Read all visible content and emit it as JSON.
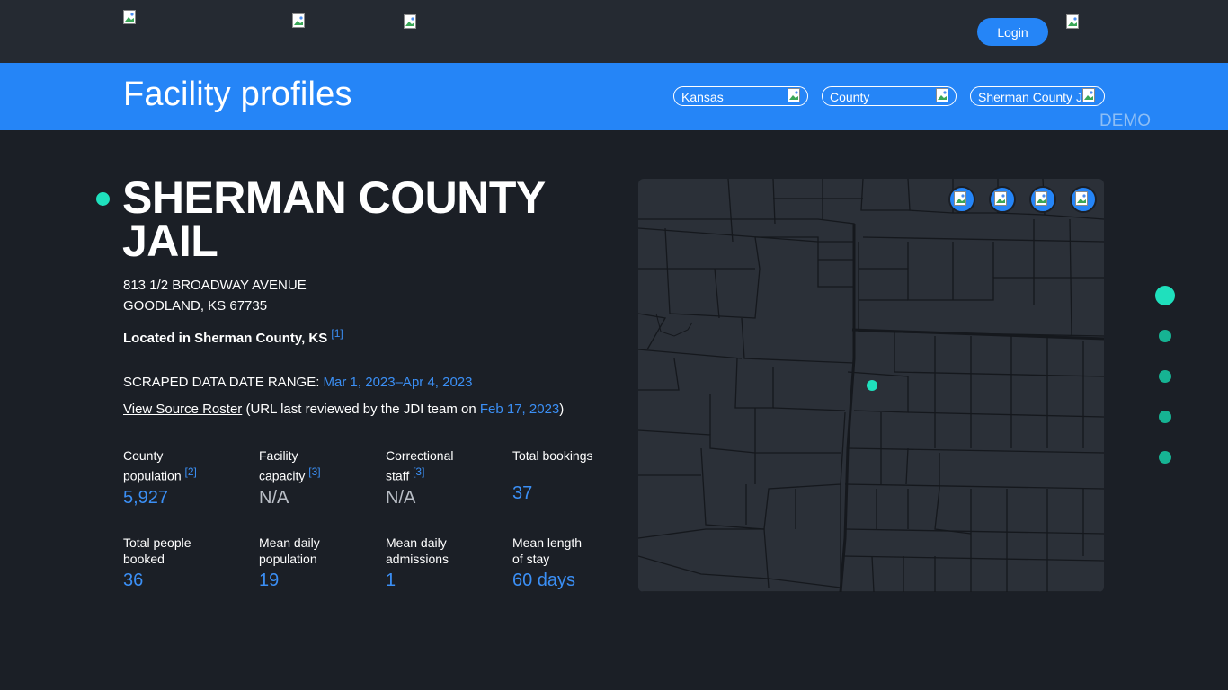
{
  "nav": {
    "login_label": "Login"
  },
  "banner": {
    "title": "Facility profiles",
    "state_select": "Kansas",
    "type_select": "County",
    "facility_select": "Sherman County J",
    "demo_label": "DEMO"
  },
  "facility": {
    "name": "SHERMAN COUNTY JAIL",
    "address_line1": "813 1/2 BROADWAY AVENUE",
    "address_line2": "GOODLAND, KS 67735",
    "located_text": "Located in Sherman County, KS",
    "located_ref": "[1]",
    "date_range_label": "SCRAPED DATA DATE RANGE:",
    "date_range_value": "Mar 1, 2023–Apr 4, 2023",
    "roster_link": "View Source Roster",
    "roster_note_pre": "(URL last reviewed by the JDI team on",
    "roster_date": "Feb 17, 2023",
    "roster_note_post": ")"
  },
  "stats": [
    {
      "label_line1": "County",
      "label_line2": "population",
      "ref": "[2]",
      "value": "5,927"
    },
    {
      "label_line1": "Facility",
      "label_line2": "capacity",
      "ref": "[3]",
      "value": "N/A"
    },
    {
      "label_line1": "Correctional",
      "label_line2": "staff",
      "ref": "[3]",
      "value": "N/A"
    },
    {
      "label_line1": "Total bookings",
      "label_line2": "",
      "ref": "",
      "value": "37"
    },
    {
      "label_line1": "Total people",
      "label_line2": "booked",
      "ref": "",
      "value": "36"
    },
    {
      "label_line1": "Mean daily",
      "label_line2": "population",
      "ref": "",
      "value": "19"
    },
    {
      "label_line1": "Mean daily",
      "label_line2": "admissions",
      "ref": "",
      "value": "1"
    },
    {
      "label_line1": "Mean length",
      "label_line2": "of stay",
      "ref": "",
      "value": "60 days"
    }
  ],
  "colors": {
    "accent_blue": "#2585f7",
    "teal": "#1fe0bd",
    "background": "#1b1f26"
  }
}
